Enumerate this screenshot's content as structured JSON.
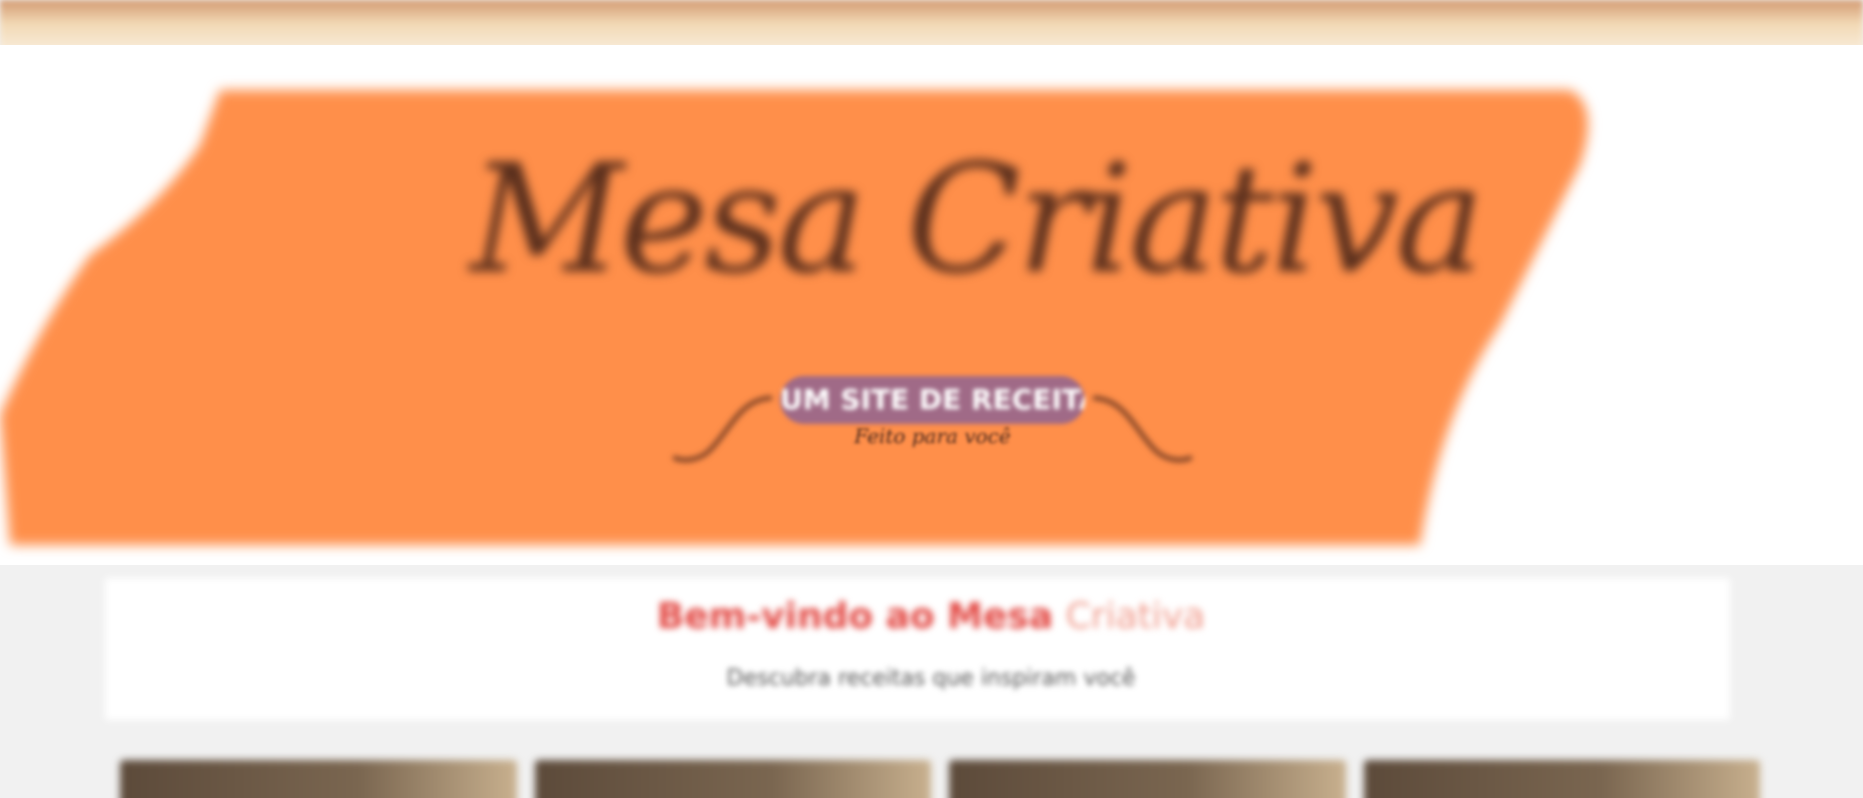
{
  "header": {
    "logo_title": "Mesa Criativa",
    "badge": "UM SITE DE RECEITAS",
    "tagline": "Feito para você",
    "brand_orange": "#ff8f4a",
    "badge_color": "#a06a87"
  },
  "welcome": {
    "title_main": "Bem-vindo ao Mesa ",
    "title_accent": "Criativa",
    "subtitle": "Descubra receitas que inspiram você",
    "title_color": "#e34a45"
  },
  "cards": [
    {
      "name": "recipe-card-1"
    },
    {
      "name": "recipe-card-2"
    },
    {
      "name": "recipe-card-3"
    },
    {
      "name": "recipe-card-4"
    }
  ]
}
